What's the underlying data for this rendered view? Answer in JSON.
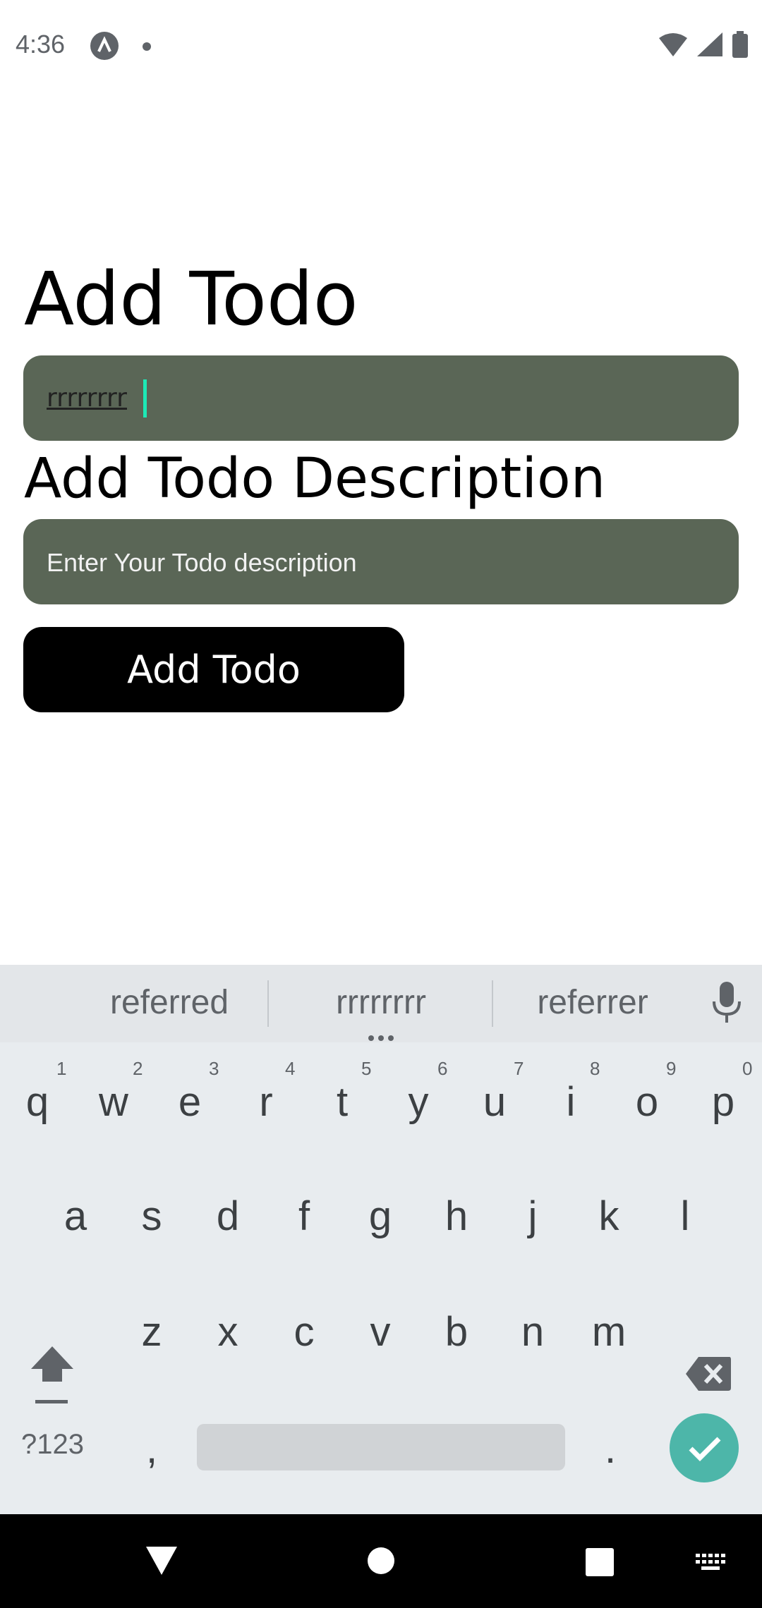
{
  "status_bar": {
    "time": "4:36"
  },
  "page": {
    "title": "Add Todo",
    "title_input_value": "rrrrrrrr",
    "description_label": "Add Todo Description",
    "description_placeholder": "Enter Your Todo description",
    "add_button_label": "Add Todo"
  },
  "keyboard": {
    "suggestions": [
      "referred",
      "rrrrrrrr",
      "referrer"
    ],
    "row1": [
      {
        "key": "q",
        "hint": "1"
      },
      {
        "key": "w",
        "hint": "2"
      },
      {
        "key": "e",
        "hint": "3"
      },
      {
        "key": "r",
        "hint": "4"
      },
      {
        "key": "t",
        "hint": "5"
      },
      {
        "key": "y",
        "hint": "6"
      },
      {
        "key": "u",
        "hint": "7"
      },
      {
        "key": "i",
        "hint": "8"
      },
      {
        "key": "o",
        "hint": "9"
      },
      {
        "key": "p",
        "hint": "0"
      }
    ],
    "row2": [
      "a",
      "s",
      "d",
      "f",
      "g",
      "h",
      "j",
      "k",
      "l"
    ],
    "row3": [
      "z",
      "x",
      "c",
      "v",
      "b",
      "n",
      "m"
    ],
    "symbols_label": "?123",
    "comma": ",",
    "period": "."
  },
  "colors": {
    "input_background": "#5a6656",
    "button_background": "#000000",
    "caret": "#1de9b6",
    "enter_key": "#4db6a9",
    "keyboard_background": "#e8ecef"
  }
}
